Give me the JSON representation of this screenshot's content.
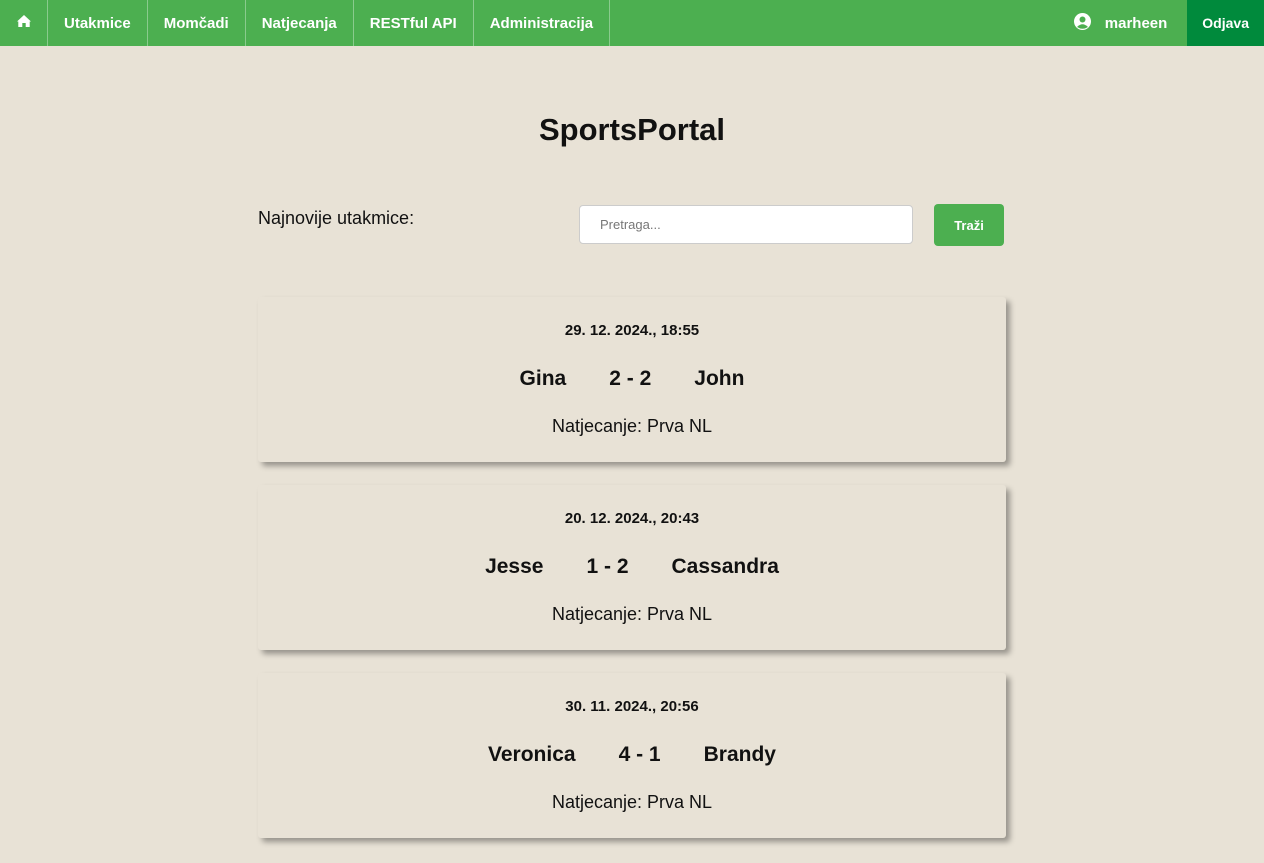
{
  "nav": {
    "home_icon": "home-icon",
    "items": [
      "Utakmice",
      "Momčadi",
      "Natjecanja",
      "RESTful API",
      "Administracija"
    ],
    "user_icon": "user-circle-icon",
    "username": "marheen",
    "logout_label": "Odjava"
  },
  "page": {
    "title": "SportsPortal",
    "latest_label": "Najnovije utakmice:",
    "search_placeholder": "Pretraga...",
    "search_button": "Traži"
  },
  "matches": [
    {
      "date": "29. 12. 2024., 18:55",
      "home": "Gina",
      "score": "2 - 2",
      "away": "John",
      "competition": "Natjecanje: Prva NL"
    },
    {
      "date": "20. 12. 2024., 20:43",
      "home": "Jesse",
      "score": "1 - 2",
      "away": "Cassandra",
      "competition": "Natjecanje: Prva NL"
    },
    {
      "date": "30. 11. 2024., 20:56",
      "home": "Veronica",
      "score": "4 - 1",
      "away": "Brandy",
      "competition": "Natjecanje: Prva NL"
    }
  ],
  "colors": {
    "accent": "#4caf50",
    "logout": "#008a3c",
    "background": "#e8e2d6"
  }
}
